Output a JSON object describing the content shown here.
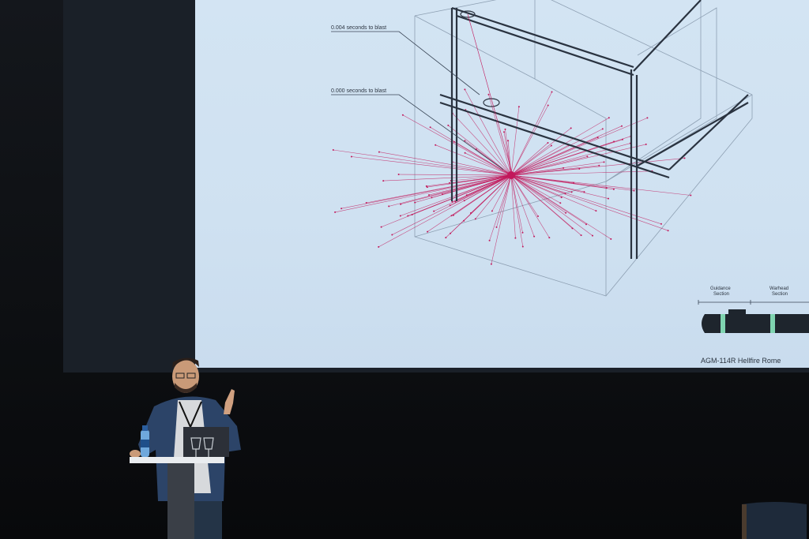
{
  "slide": {
    "annotations": [
      "0.004 seconds to blast",
      "0.000 seconds to blast"
    ],
    "missile_labels": {
      "guidance": [
        "Guidance",
        "Section"
      ],
      "warhead": [
        "Warhead",
        "Section"
      ]
    },
    "caption": "AGM-114R Hellfire Rome"
  },
  "colors": {
    "slide_bg": "#cfe1f1",
    "burst": "#c2185b",
    "structure": "#2a3340"
  }
}
